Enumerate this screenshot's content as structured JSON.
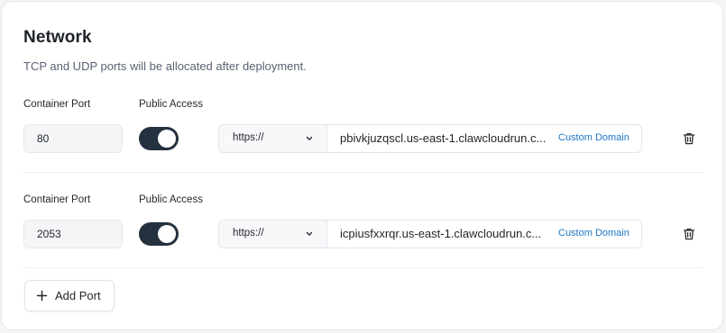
{
  "section": {
    "title": "Network",
    "subtitle": "TCP and UDP ports will be allocated after deployment."
  },
  "ports": [
    {
      "port_label": "Container Port",
      "port_value": "80",
      "access_label": "Public Access",
      "public_access": true,
      "protocol": "https://",
      "domain": "pbivkjuzqscl.us-east-1.clawcloudrun.c...",
      "custom_domain_label": "Custom Domain"
    },
    {
      "port_label": "Container Port",
      "port_value": "2053",
      "access_label": "Public Access",
      "public_access": true,
      "protocol": "https://",
      "domain": "icpiusfxxrqr.us-east-1.clawcloudrun.c...",
      "custom_domain_label": "Custom Domain"
    }
  ],
  "add_port_label": "Add Port",
  "icons": {
    "protocol_dropdown": "chevron-down-icon",
    "delete": "trash-icon",
    "add": "plus-icon"
  },
  "colors": {
    "toggle_on": "#24313f",
    "link": "#1b78c8",
    "muted_text": "#596273"
  }
}
